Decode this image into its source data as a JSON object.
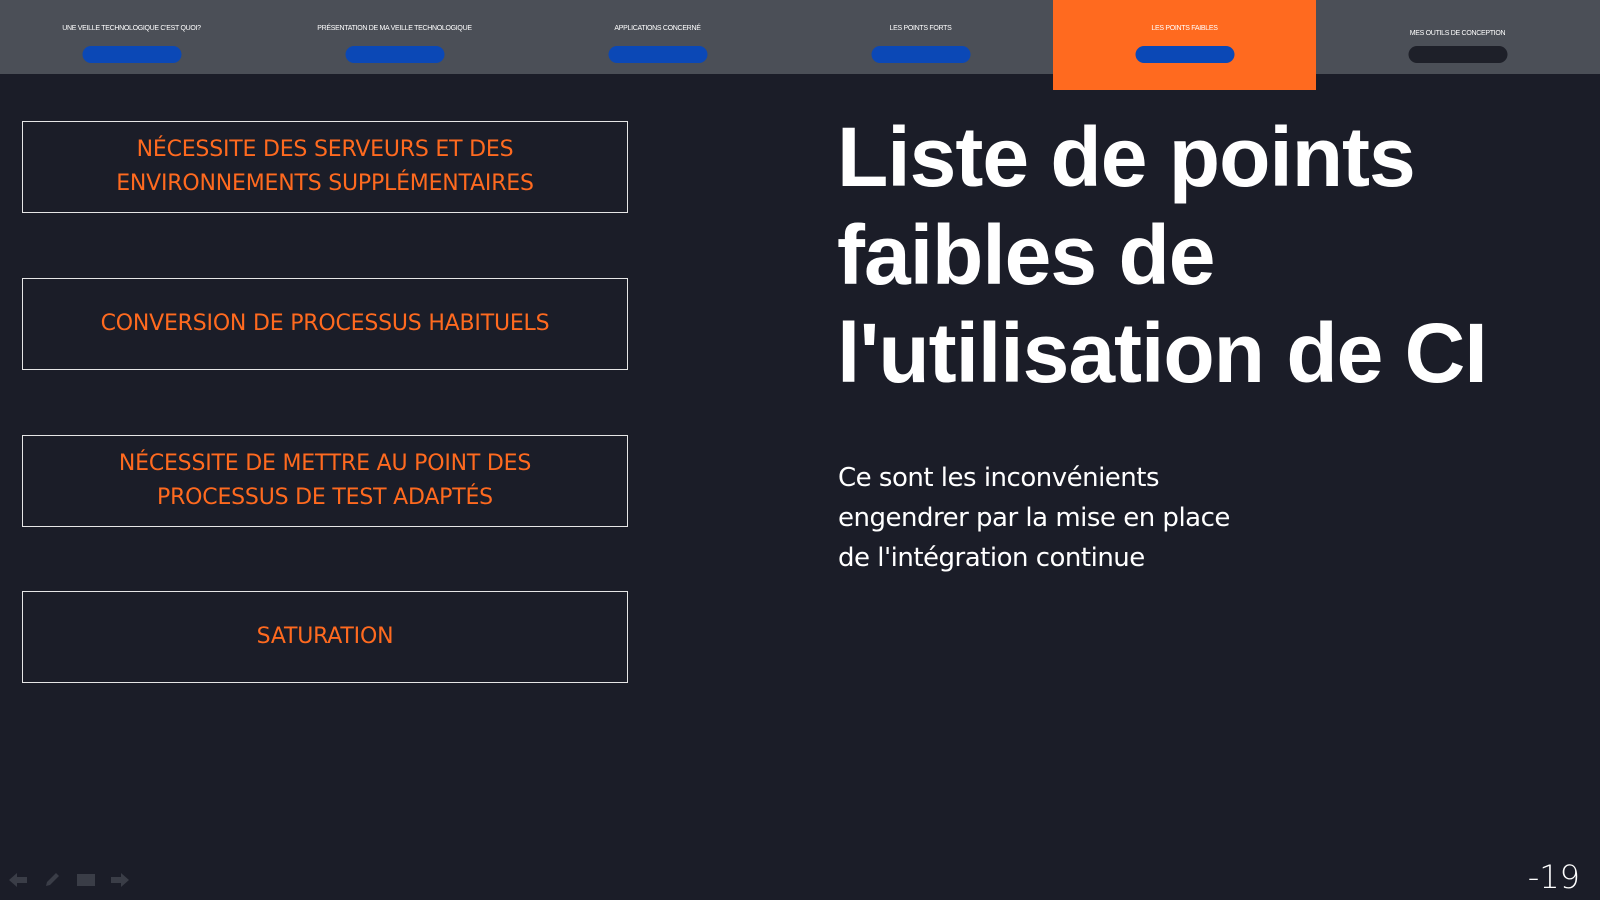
{
  "nav": {
    "tabs": [
      {
        "label": "UNE VEILLE TECHNOLOGIQUE C'EST QUOI?",
        "active": false,
        "pill": "blue"
      },
      {
        "label": "PRÉSENTATION DE MA VEILLE TECHNOLOGIQUE",
        "active": false,
        "pill": "blue"
      },
      {
        "label": "APPLICATIONS CONCERNÉ",
        "active": false,
        "pill": "blue"
      },
      {
        "label": "LES POINTS FORTS",
        "active": false,
        "pill": "blue"
      },
      {
        "label": "LES POINTS FAIBLES",
        "active": true,
        "pill": "blue"
      },
      {
        "label": "MES OUTILS DE CONCEPTION",
        "active": false,
        "pill": "dark"
      }
    ]
  },
  "weaknesses": [
    "NÉCESSITE DES SERVEURS ET DES ENVIRONNEMENTS SUPPLÉMENTAIRES",
    "CONVERSION DE PROCESSUS HABITUELS",
    "NÉCESSITE DE METTRE AU POINT DES PROCESSUS DE TEST ADAPTÉS",
    "SATURATION"
  ],
  "title": "Liste de points faibles de l'utilisation de CI",
  "description": "Ce sont les inconvénients engendrer par la mise en place de l'intégration continue",
  "page_number": "-19",
  "colors": {
    "accent": "#ff6a1f",
    "background": "#1b1d28",
    "nav_bar": "#4b4f57",
    "pill_blue": "#0b48b6",
    "pill_dark": "#1e2029"
  },
  "controls": [
    "back-arrow-icon",
    "pen-icon",
    "screen-icon",
    "forward-arrow-icon"
  ]
}
